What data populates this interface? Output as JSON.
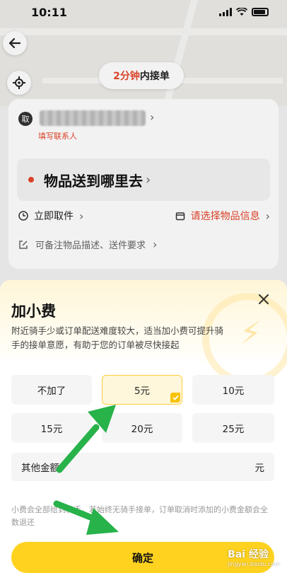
{
  "status_bar": {
    "time": "10:11"
  },
  "map": {
    "pickup_prefix": "2分钟",
    "pickup_suffix": "内接单"
  },
  "address_card": {
    "badge": "取",
    "fill_contact": "填写联系人",
    "destination": "物品送到哪里去",
    "pickup_time": "立即取件",
    "item_info": "请选择物品信息",
    "remark": "可备注物品描述、送件要求"
  },
  "sheet": {
    "title": "加小费",
    "description": "附近骑手少或订单配送难度较大，适当加小费可提升骑手的接单意愿，有助于您的订单被尽快接起",
    "options": [
      "不加了",
      "5元",
      "10元",
      "15元",
      "20元",
      "25元"
    ],
    "selected_option": "5元",
    "other_label": "其他金额",
    "other_unit": "元",
    "note": "小费会全部给到骑手，若始终无骑手接单，订单取消时添加的小费金额会全数退还",
    "confirm_label": "确定"
  },
  "watermark": {
    "main": "Bai 经验",
    "sub": "jingyan.baidu.com"
  },
  "colors": {
    "accent_yellow": "#ffd21f",
    "highlight_red": "#e6462b",
    "arrow_green": "#27b24a"
  }
}
